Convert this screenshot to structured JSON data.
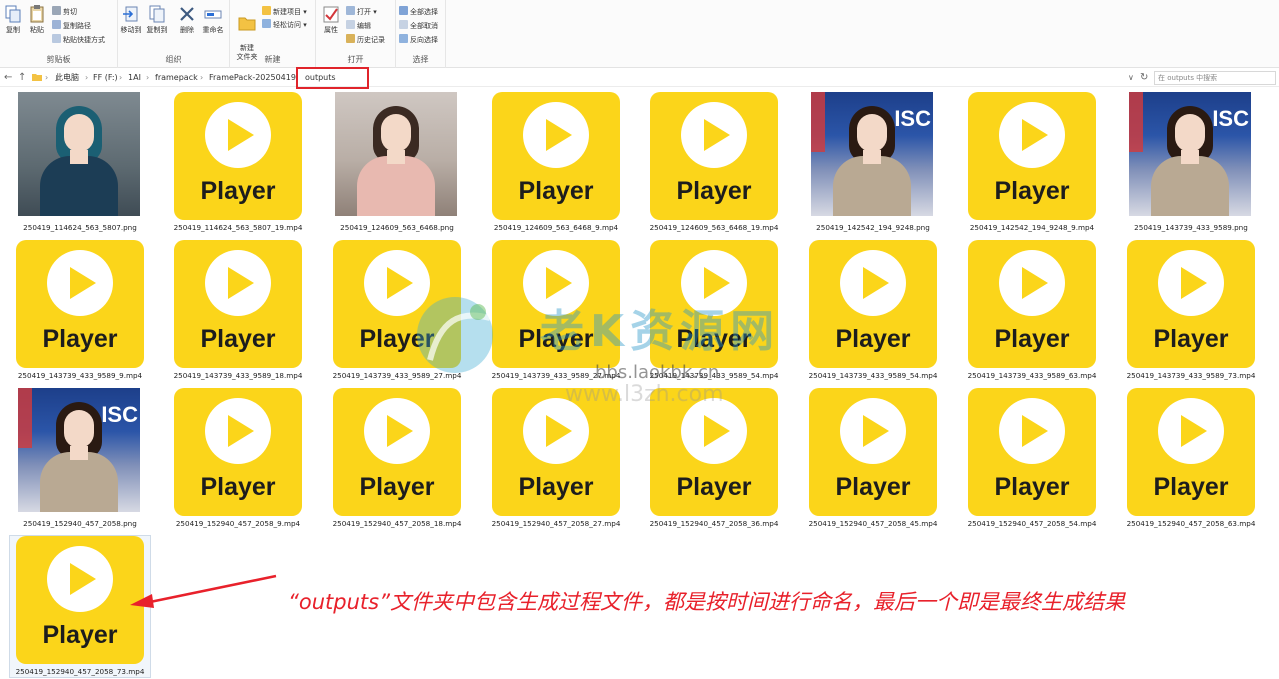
{
  "ribbon": {
    "clipboard": {
      "label": "剪贴板",
      "copy": "复制",
      "paste": "粘贴",
      "cut": "剪切",
      "copy_path": "复制路径",
      "paste_shortcut": "粘贴快捷方式"
    },
    "organize": {
      "label": "组织",
      "move_to": "移动到",
      "copy_to": "复制到",
      "delete": "删除",
      "rename": "重命名"
    },
    "new": {
      "label": "新建",
      "new_folder": "新建\n文件夹",
      "new_item": "新建项目 ▾",
      "easy_access": "轻松访问 ▾"
    },
    "open": {
      "label": "打开",
      "properties": "属性",
      "open": "打开 ▾",
      "edit": "编辑",
      "history": "历史记录"
    },
    "select": {
      "label": "选择",
      "select_all": "全部选择",
      "select_none": "全部取消",
      "invert": "反向选择"
    },
    "colors": {
      "accent": "#2b6fd6",
      "red": "#d4373b",
      "folder": "#f3c243"
    }
  },
  "address": {
    "back": "←",
    "forward": "→",
    "up": "↑",
    "crumbs": [
      "此电脑",
      "FF (F:)",
      "1AI",
      "framepack",
      "FramePack-20250419",
      "outputs"
    ],
    "refresh": "↻",
    "dropdown": "∨",
    "search_placeholder": "在 outputs 中搜索"
  },
  "files": [
    {
      "name": "250419_114624_563_5807.png",
      "kind": "photo-teal"
    },
    {
      "name": "250419_114624_563_5807_19.mp4",
      "kind": "video"
    },
    {
      "name": "250419_124609_563_6468.png",
      "kind": "photo-pink"
    },
    {
      "name": "250419_124609_563_6468_9.mp4",
      "kind": "video"
    },
    {
      "name": "250419_124609_563_6468_19.mp4",
      "kind": "video"
    },
    {
      "name": "250419_142542_194_9248.png",
      "kind": "photo-news"
    },
    {
      "name": "250419_142542_194_9248_9.mp4",
      "kind": "video"
    },
    {
      "name": "250419_143739_433_9589.png",
      "kind": "photo-news"
    },
    {
      "name": "250419_143739_433_9589_9.mp4",
      "kind": "video"
    },
    {
      "name": "250419_143739_433_9589_18.mp4",
      "kind": "video"
    },
    {
      "name": "250419_143739_433_9589_27.mp4",
      "kind": "video"
    },
    {
      "name": "250419_143739_433_9589_27.mp4",
      "kind": "video"
    },
    {
      "name": "250419_143739_433_9589_54.mp4",
      "kind": "video"
    },
    {
      "name": "250419_143739_433_9589_54.mp4",
      "kind": "video"
    },
    {
      "name": "250419_143739_433_9589_63.mp4",
      "kind": "video"
    },
    {
      "name": "250419_143739_433_9589_73.mp4",
      "kind": "video"
    },
    {
      "name": "250419_152940_457_2058.png",
      "kind": "photo-news"
    },
    {
      "name": "250419_152940_457_2058_9.mp4",
      "kind": "video"
    },
    {
      "name": "250419_152940_457_2058_18.mp4",
      "kind": "video"
    },
    {
      "name": "250419_152940_457_2058_27.mp4",
      "kind": "video"
    },
    {
      "name": "250419_152940_457_2058_36.mp4",
      "kind": "video"
    },
    {
      "name": "250419_152940_457_2058_45.mp4",
      "kind": "video"
    },
    {
      "name": "250419_152940_457_2058_54.mp4",
      "kind": "video"
    },
    {
      "name": "250419_152940_457_2058_63.mp4",
      "kind": "video"
    },
    {
      "name": "250419_152940_457_2058_73.mp4",
      "kind": "video"
    }
  ],
  "player_label": "Player",
  "news_backdrop_text": "ISC",
  "watermark": {
    "text": "老K资源网",
    "url1": "bbs.laokbk.cn",
    "url2": "www.l3zh.com"
  },
  "annotation": {
    "text": "“outputs”文件夹中包含生成过程文件，都是按时间进行命名，最后一个即是最终生成结果",
    "color": "#e8212b"
  },
  "colors": {
    "player_yellow": "#fbd51a",
    "highlight_red": "#e0242b"
  }
}
